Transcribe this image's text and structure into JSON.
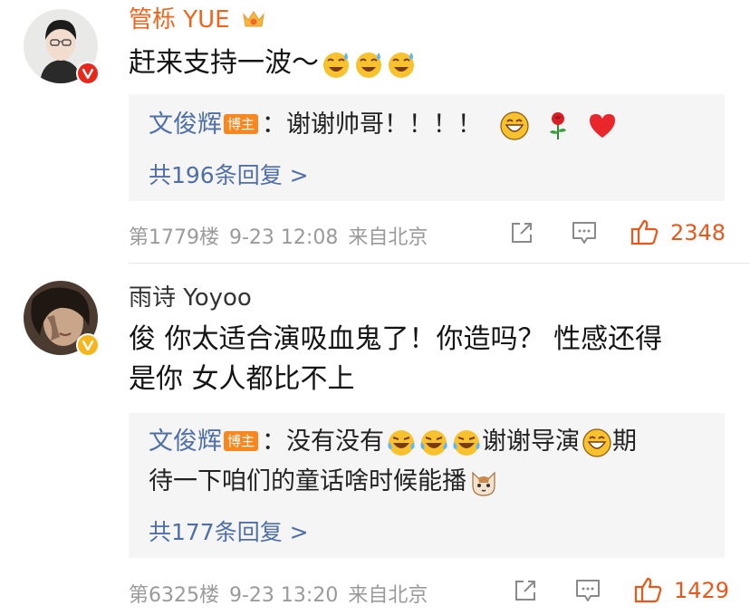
{
  "comments": [
    {
      "username": "管栎 YUE",
      "text": "赶来支持一波～",
      "reply": {
        "author": "文俊辉",
        "tag": "博主",
        "text": "：谢谢帅哥！！！！",
        "count_label": "共196条回复 >"
      },
      "floor": "第1779楼",
      "date": "9-23 12:08",
      "source": "来自北京",
      "likes": "2348"
    },
    {
      "username": "雨诗 Yoyoo",
      "text_line1": "俊 你太适合演吸血鬼了！你造吗？ 性感还得",
      "text_line2": "是你 女人都比不上",
      "reply": {
        "author": "文俊辉",
        "tag": "博主",
        "text_a": "：没有没有",
        "text_b": "谢谢导演",
        "text_c": "期",
        "text_line2": "待一下咱们的童话啥时候能播",
        "count_label": "共177条回复 >"
      },
      "floor": "第6325楼",
      "date": "9-23 13:20",
      "source": "来自北京",
      "likes": "1429"
    }
  ],
  "colors": {
    "username_vip": "#f2641b",
    "username_normal": "#333333",
    "link_blue": "#4f6fa9",
    "like_orange": "#e8581b",
    "badge_red": "#e8261b",
    "badge_yellow": "#f5b51b"
  },
  "icons": [
    "crown-icon",
    "verified-badge-icon",
    "sweat-laugh-emoji",
    "grin-emoji",
    "rose-emoji",
    "heart-emoji",
    "tears-laugh-emoji",
    "cat-emoji",
    "share-icon",
    "comment-icon",
    "like-icon"
  ]
}
